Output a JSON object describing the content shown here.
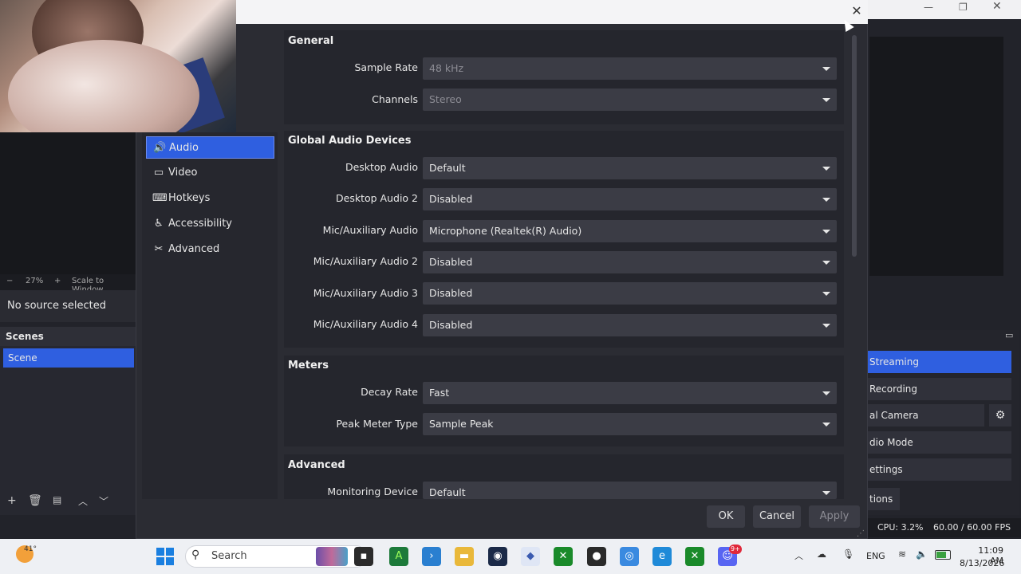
{
  "main_window": {
    "scale": {
      "zoom": "27%",
      "scale_label": "Scale to Window"
    },
    "no_source": "No source selected",
    "scenes": {
      "title": "Scenes",
      "items": [
        "Scene"
      ]
    },
    "controls": {
      "streaming": "Streaming",
      "recording": "Recording",
      "virtual_camera": "al Camera",
      "studio_mode": "dio Mode",
      "settings": "ettings",
      "exit": "tions"
    },
    "status": {
      "cpu": "CPU: 3.2%",
      "fps": "60.00 / 60.00 FPS"
    }
  },
  "settings": {
    "nav": [
      {
        "label": "Audio",
        "icon": "speaker-icon",
        "active": true
      },
      {
        "label": "Video",
        "icon": "monitor-icon"
      },
      {
        "label": "Hotkeys",
        "icon": "keyboard-icon"
      },
      {
        "label": "Accessibility",
        "icon": "accessibility-icon"
      },
      {
        "label": "Advanced",
        "icon": "tools-icon"
      }
    ],
    "general": {
      "title": "General",
      "sample_rate_label": "Sample Rate",
      "sample_rate": "48 kHz",
      "channels_label": "Channels",
      "channels": "Stereo"
    },
    "global_audio": {
      "title": "Global Audio Devices",
      "rows": [
        {
          "label": "Desktop Audio",
          "value": "Default"
        },
        {
          "label": "Desktop Audio 2",
          "value": "Disabled"
        },
        {
          "label": "Mic/Auxiliary Audio",
          "value": "Microphone (Realtek(R) Audio)"
        },
        {
          "label": "Mic/Auxiliary Audio 2",
          "value": "Disabled"
        },
        {
          "label": "Mic/Auxiliary Audio 3",
          "value": "Disabled"
        },
        {
          "label": "Mic/Auxiliary Audio 4",
          "value": "Disabled"
        }
      ]
    },
    "meters": {
      "title": "Meters",
      "decay_label": "Decay Rate",
      "decay": "Fast",
      "peak_label": "Peak Meter Type",
      "peak": "Sample Peak"
    },
    "advanced": {
      "title": "Advanced",
      "monitoring_label": "Monitoring Device",
      "monitoring": "Default"
    },
    "buttons": {
      "ok": "OK",
      "cancel": "Cancel",
      "apply": "Apply"
    }
  },
  "taskbar": {
    "weather_temp": "41°",
    "search_placeholder": "Search",
    "tray": {
      "lang": "ENG",
      "time": "11:09 AM",
      "date": "8/13/2026"
    },
    "discord_badge": "9+"
  },
  "colors": {
    "accent": "#2f5fe0",
    "dialog_bg": "#2b2c33",
    "combo_bg": "#3b3c45"
  }
}
